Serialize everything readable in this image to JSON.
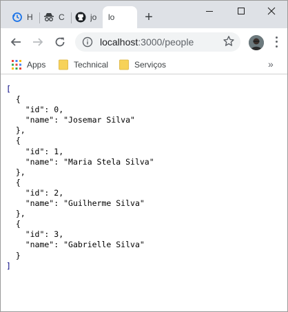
{
  "tabs": [
    {
      "title": "H",
      "icon": "history-icon",
      "active": false
    },
    {
      "title": "C",
      "icon": "incognito-icon",
      "active": false
    },
    {
      "title": "jo",
      "icon": "github-icon",
      "active": false
    },
    {
      "title": "lo",
      "icon": "page-icon",
      "active": true
    }
  ],
  "address_bar": {
    "host": "localhost",
    "path": ":3000/people"
  },
  "bookmarks": [
    {
      "label": "Apps",
      "icon": "apps-grid-icon"
    },
    {
      "label": "Technical",
      "icon": "folder-icon"
    },
    {
      "label": "Serviços",
      "icon": "folder-icon"
    }
  ],
  "json_output": {
    "open_bracket": "[",
    "close_bracket": "]",
    "people": [
      {
        "id": "0",
        "name": "\"Josemar Silva\""
      },
      {
        "id": "1",
        "name": "\"Maria Stela Silva\""
      },
      {
        "id": "2",
        "name": "\"Guilherme Silva\""
      },
      {
        "id": "3",
        "name": "\"Gabrielle Silva\""
      }
    ]
  },
  "colors": {
    "tabstrip_bg": "#dee1e6",
    "omnibox_bg": "#f1f3f4",
    "folder_yellow": "#f7d259"
  }
}
